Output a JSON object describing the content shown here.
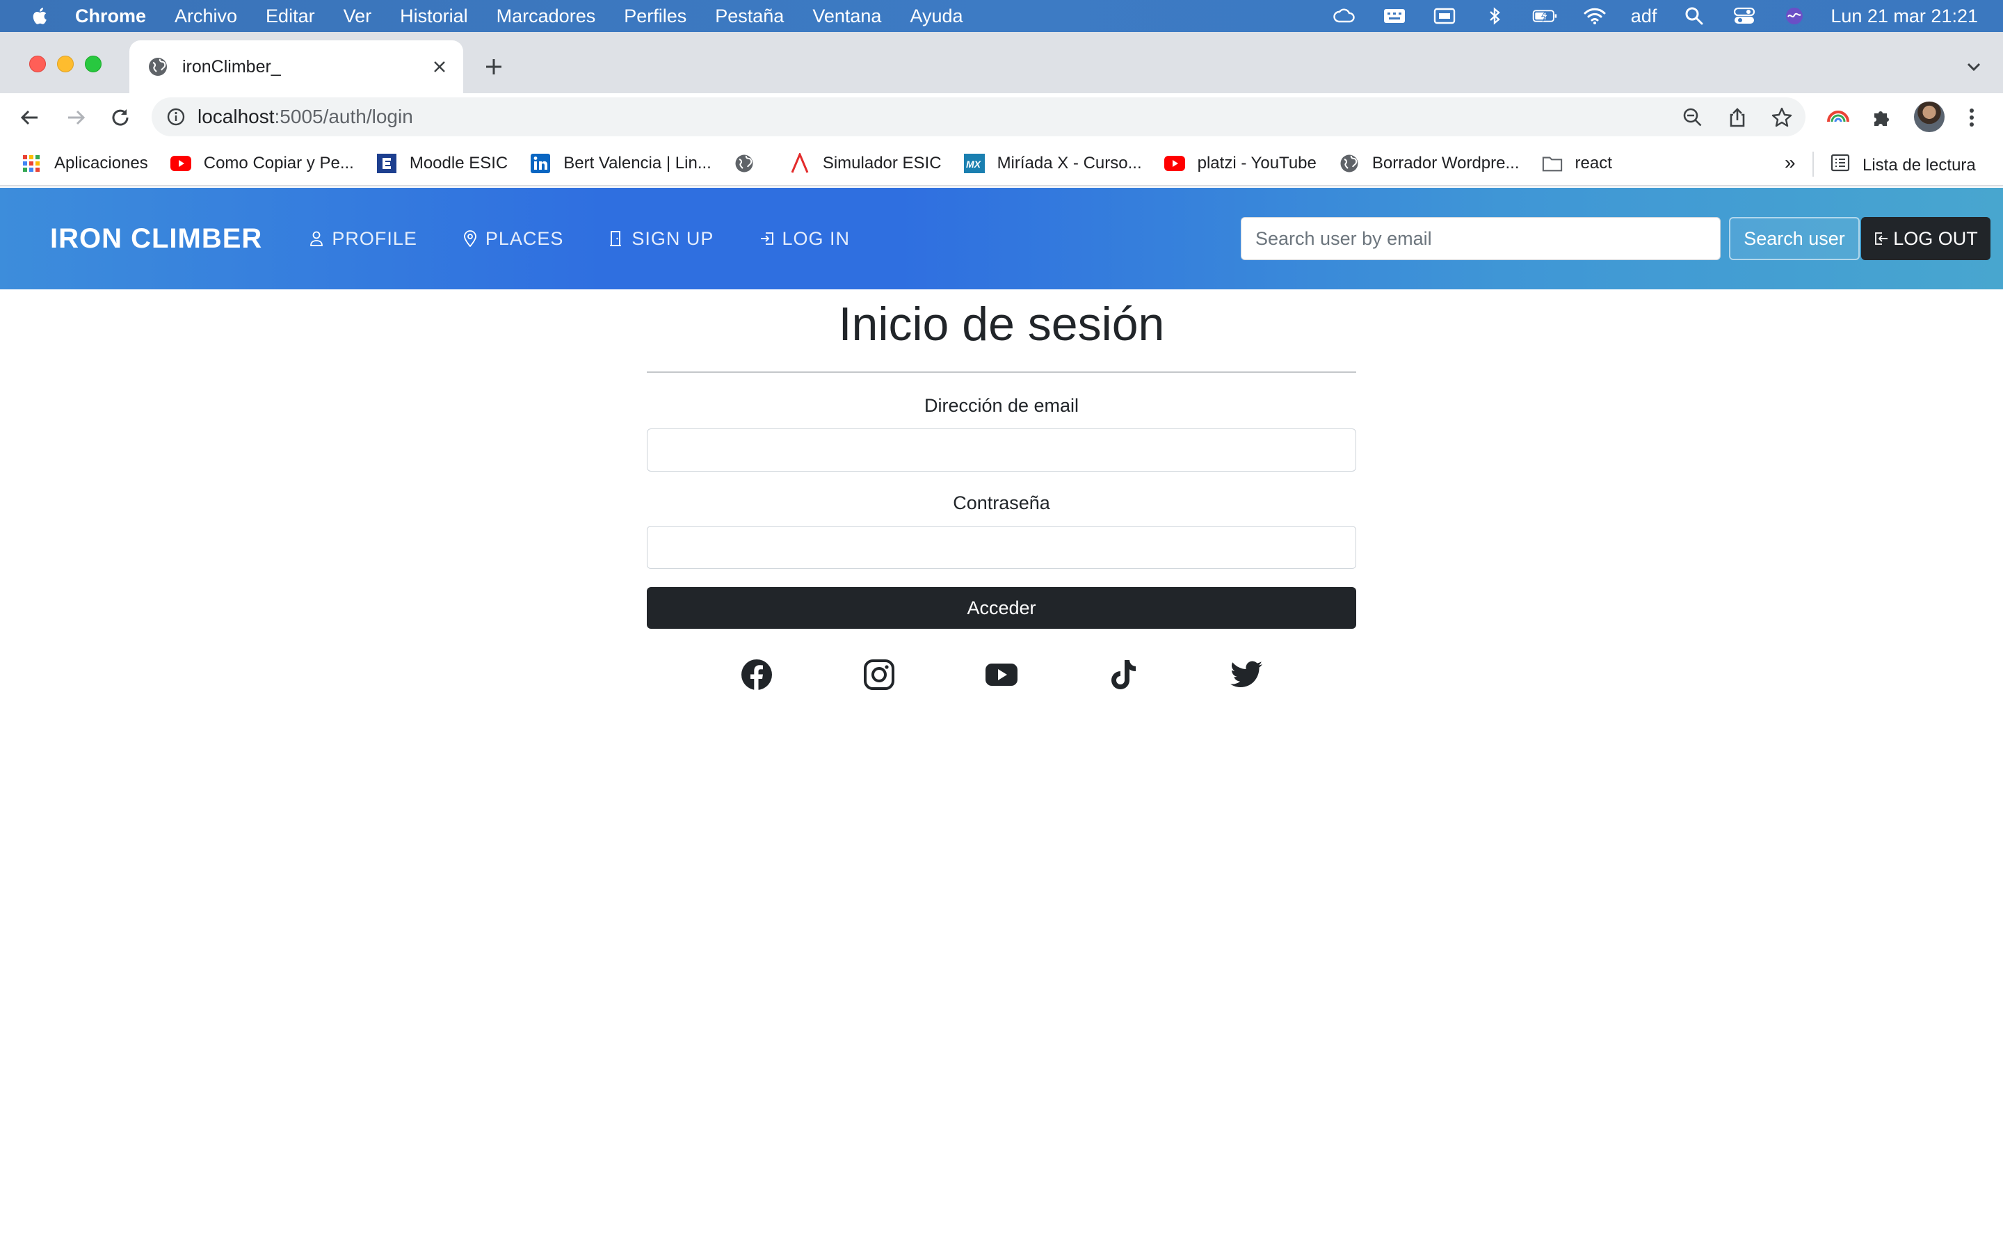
{
  "menubar": {
    "app": "Chrome",
    "items": [
      "Archivo",
      "Editar",
      "Ver",
      "Historial",
      "Marcadores",
      "Perfiles",
      "Pestaña",
      "Ventana",
      "Ayuda"
    ],
    "user": "adf",
    "datetime": "Lun 21 mar  21:21"
  },
  "browser": {
    "tab_title": "ironClimber_",
    "url_host": "localhost",
    "url_path": ":5005/auth/login"
  },
  "bookmarks": {
    "items": [
      "Aplicaciones",
      "Como Copiar y Pe...",
      "Moodle ESIC",
      "Bert Valencia | Lin...",
      "",
      "Simulador ESIC",
      "Miríada X - Curso...",
      "platzi - YouTube",
      "Borrador Wordpre...",
      "react"
    ],
    "more": "»",
    "reading_list": "Lista de lectura"
  },
  "site_nav": {
    "brand": "IRON CLIMBER",
    "links": [
      "PROFILE",
      "PLACES",
      "SIGN UP",
      "LOG IN"
    ],
    "search_placeholder": "Search user by email",
    "search_button": "Search user",
    "logout": "LOG OUT"
  },
  "login": {
    "title": "Inicio de sesión",
    "email_label": "Dirección de email",
    "email_value": "",
    "password_label": "Contraseña",
    "password_value": "",
    "submit": "Acceder"
  },
  "social_icons": [
    "facebook-icon",
    "instagram-icon",
    "youtube-icon",
    "tiktok-icon",
    "twitter-icon"
  ]
}
